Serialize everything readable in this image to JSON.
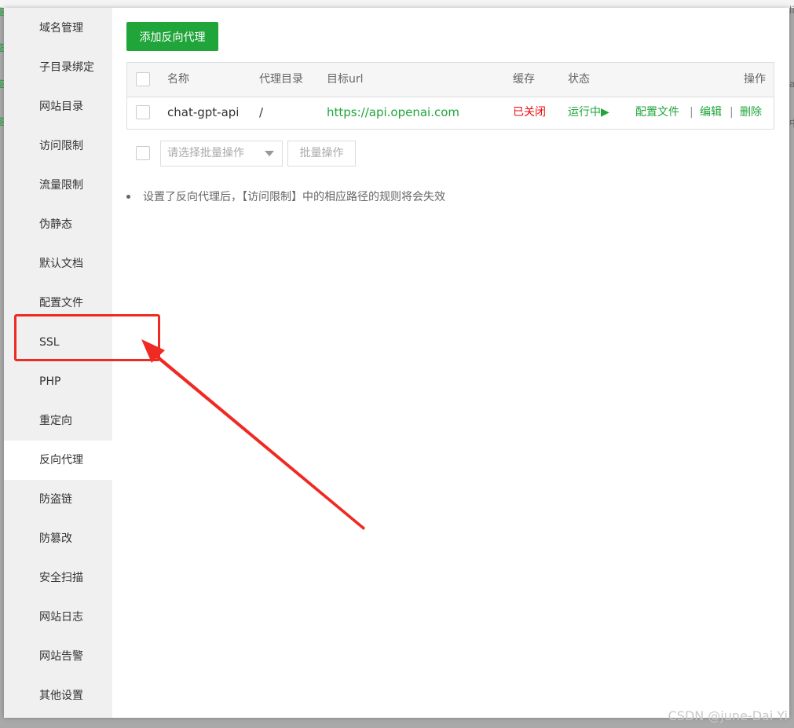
{
  "background": {
    "left_fragments": [
      "鉴",
      "鉴",
      "鉴",
      "鉴"
    ],
    "right_fragments": [
      "li",
      "a",
      "中"
    ]
  },
  "sidebar": {
    "items": [
      {
        "label": "域名管理"
      },
      {
        "label": "子目录绑定"
      },
      {
        "label": "网站目录"
      },
      {
        "label": "访问限制"
      },
      {
        "label": "流量限制"
      },
      {
        "label": "伪静态"
      },
      {
        "label": "默认文档"
      },
      {
        "label": "配置文件"
      },
      {
        "label": "SSL"
      },
      {
        "label": "PHP"
      },
      {
        "label": "重定向"
      },
      {
        "label": "反向代理"
      },
      {
        "label": "防盗链"
      },
      {
        "label": "防篡改"
      },
      {
        "label": "安全扫描"
      },
      {
        "label": "网站日志"
      },
      {
        "label": "网站告警"
      },
      {
        "label": "其他设置"
      }
    ],
    "active": "反向代理"
  },
  "main": {
    "add_button": "添加反向代理",
    "table": {
      "headers": {
        "name": "名称",
        "proxy_dir": "代理目录",
        "target_url": "目标url",
        "cache": "缓存",
        "status": "状态",
        "actions": "操作"
      },
      "rows": [
        {
          "name": "chat-gpt-api",
          "proxy_dir": "/",
          "target_url": "https://api.openai.com",
          "cache": "已关闭",
          "status": "运行中▶",
          "action_config": "配置文件",
          "action_edit": "编辑",
          "action_delete": "删除",
          "separator": "|"
        }
      ]
    },
    "batch_select_placeholder": "请选择批量操作",
    "batch_button": "批量操作",
    "tip": "设置了反向代理后，【访问限制】中的相应路径的规则将会失效"
  },
  "colors": {
    "accent_green": "#20a53a",
    "closed_red": "#ef0808",
    "annotation_red": "#ef2a23"
  },
  "watermark": "CSDN @june-Dai Yi"
}
